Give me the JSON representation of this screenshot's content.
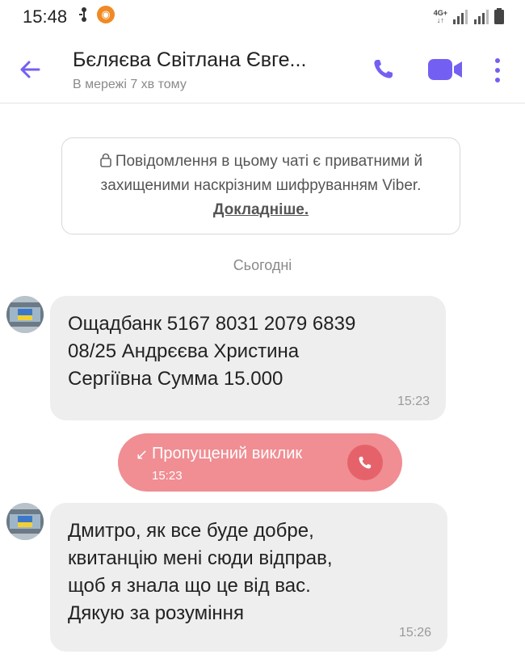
{
  "status_bar": {
    "time": "15:48",
    "network_top": "4G+",
    "network_bottom": "↓↑"
  },
  "header": {
    "contact_name": "Бєляєва Світлана Євге...",
    "contact_status": "В мережі 7 хв тому",
    "icons": [
      "back-arrow-icon",
      "phone-icon",
      "video-icon",
      "more-vert-icon"
    ],
    "accent_color": "#7360f2"
  },
  "encryption_notice": {
    "text": "Повідомлення в цьому чаті є приватними й захищеними наскрізним шифруванням Viber.",
    "link": "Докладніше."
  },
  "date_separator": "Сьогодні",
  "messages": [
    {
      "text": "Ощадбанк 5167 8031 2079 6839\n08/25 Андрєєва Христина\nСергіївна Сумма 15.000",
      "time": "15:23"
    },
    {
      "text": "Дмитро, як все буде добре,\nквитанцію мені сюди відправ,\nщоб я знала що це від вас.\nДякую за розуміння",
      "time": "15:26"
    }
  ],
  "missed_call": {
    "label": "Пропущений виклик",
    "time": "15:23",
    "color": "#f08e93"
  }
}
